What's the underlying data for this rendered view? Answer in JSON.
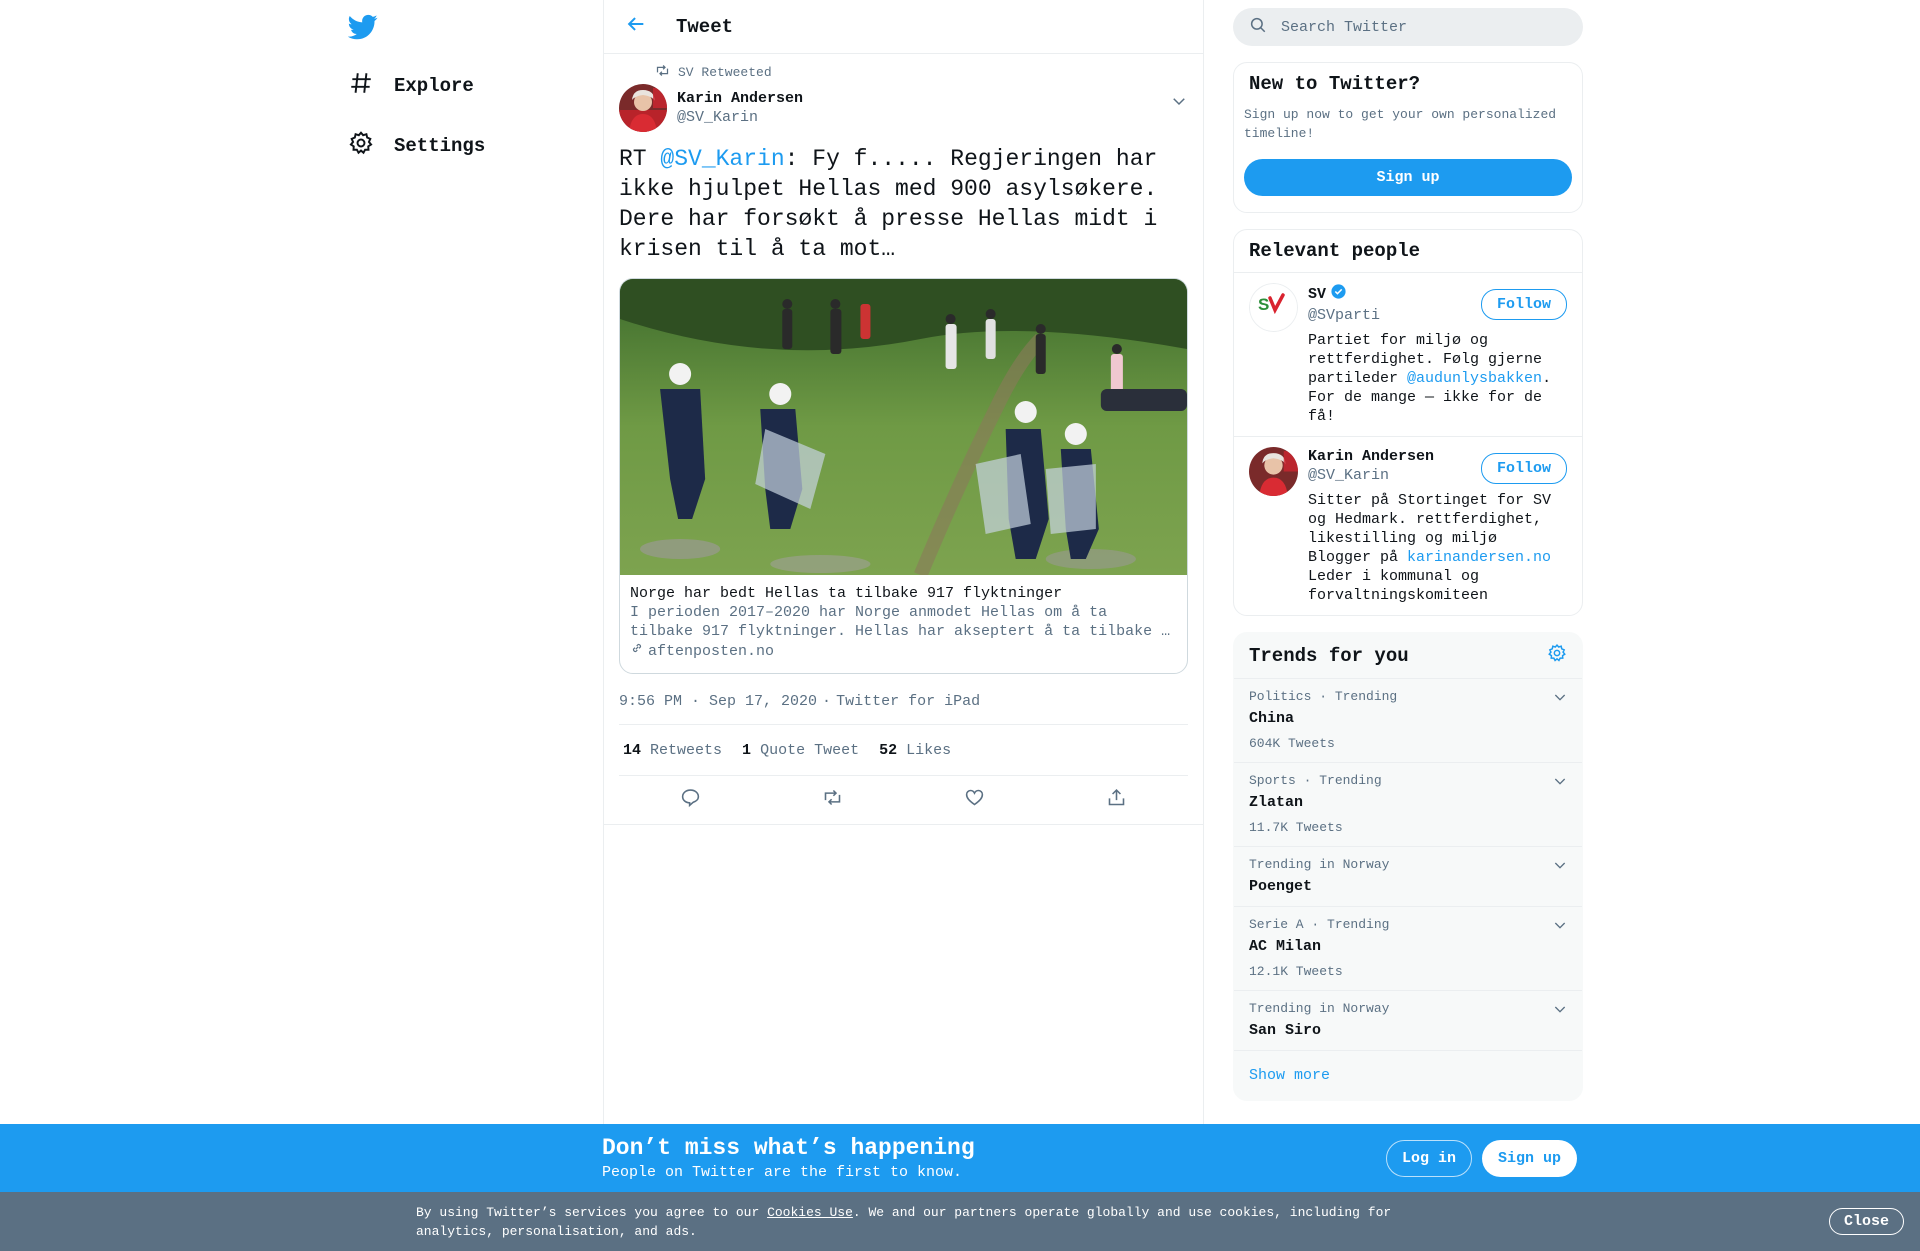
{
  "nav": {
    "logo": "twitter-bird-icon",
    "items": [
      {
        "label": "Explore",
        "icon": "hashtag-icon"
      },
      {
        "label": "Settings",
        "icon": "gear-icon"
      }
    ]
  },
  "header": {
    "title": "Tweet"
  },
  "tweet": {
    "retweeted_by": "SV Retweeted",
    "author_name": "Karin Andersen",
    "author_handle": "@SV_Karin",
    "text_prefix": "RT ",
    "text_mention": "@SV_Karin",
    "text_body": ": Fy f..... Regjeringen har ikke hjulpet Hellas med 900 asylsøkere. Dere har forsøkt å presse Hellas midt i krisen til å ta mot…",
    "card": {
      "title": "Norge har bedt Hellas ta tilbake 917 flyktninger",
      "description": "I perioden 2017–2020 har Norge anmodet Hellas om å ta tilbake 917 flyktninger. Hellas har akseptert å ta tilbake …",
      "domain": "aftenposten.no"
    },
    "time": "9:56 PM · Sep 17, 2020",
    "separator": "·",
    "source": "Twitter for iPad",
    "stats": [
      {
        "num": "14",
        "label": "Retweets"
      },
      {
        "num": "1",
        "label": "Quote Tweet"
      },
      {
        "num": "52",
        "label": "Likes"
      }
    ]
  },
  "search": {
    "placeholder": "Search Twitter"
  },
  "new_to_twitter": {
    "title": "New to Twitter?",
    "subtitle": "Sign up now to get your own personalized timeline!",
    "button": "Sign up"
  },
  "relevant": {
    "title": "Relevant people",
    "people": [
      {
        "name": "SV",
        "handle": "@SVparti",
        "follow": "Follow",
        "bio_1": "Partiet for miljø og rettferdighet. Følg gjerne partileder ",
        "bio_link": "@audunlysbakken",
        "bio_2": ". For de mange — ikke for de få!"
      },
      {
        "name": "Karin Andersen",
        "handle": "@SV_Karin",
        "follow": "Follow",
        "bio_1": "Sitter på Stortinget for SV og Hedmark. rettferdighet, likestilling og miljø Blogger på ",
        "bio_link": "karinandersen.no",
        "bio_2": " Leder i kommunal og forvaltningskomiteen"
      }
    ]
  },
  "trends": {
    "title": "Trends for you",
    "items": [
      {
        "context": "Politics · Trending",
        "name": "China",
        "count": "604K Tweets"
      },
      {
        "context": "Sports · Trending",
        "name": "Zlatan",
        "count": "11.7K Tweets"
      },
      {
        "context": "Trending in Norway",
        "name": "Poenget",
        "count": ""
      },
      {
        "context": "Serie A · Trending",
        "name": "AC Milan",
        "count": "12.1K Tweets"
      },
      {
        "context": "Trending in Norway",
        "name": "San Siro",
        "count": ""
      }
    ],
    "show_more": "Show more"
  },
  "promo": {
    "title": "Don’t miss what’s happening",
    "subtitle": "People on Twitter are the first to know.",
    "login": "Log in",
    "signup": "Sign up"
  },
  "cookie": {
    "text_1": "By using Twitter’s services you agree to our ",
    "link": "Cookies Use",
    "text_2": ". We and our partners operate globally and use cookies, including for analytics, personalisation, and ads.",
    "close": "Close"
  },
  "colors": {
    "accent": "#1d9bf0",
    "muted": "#5b7083",
    "cookie_bg": "#5b7083",
    "verified": "#1d9bf0"
  }
}
